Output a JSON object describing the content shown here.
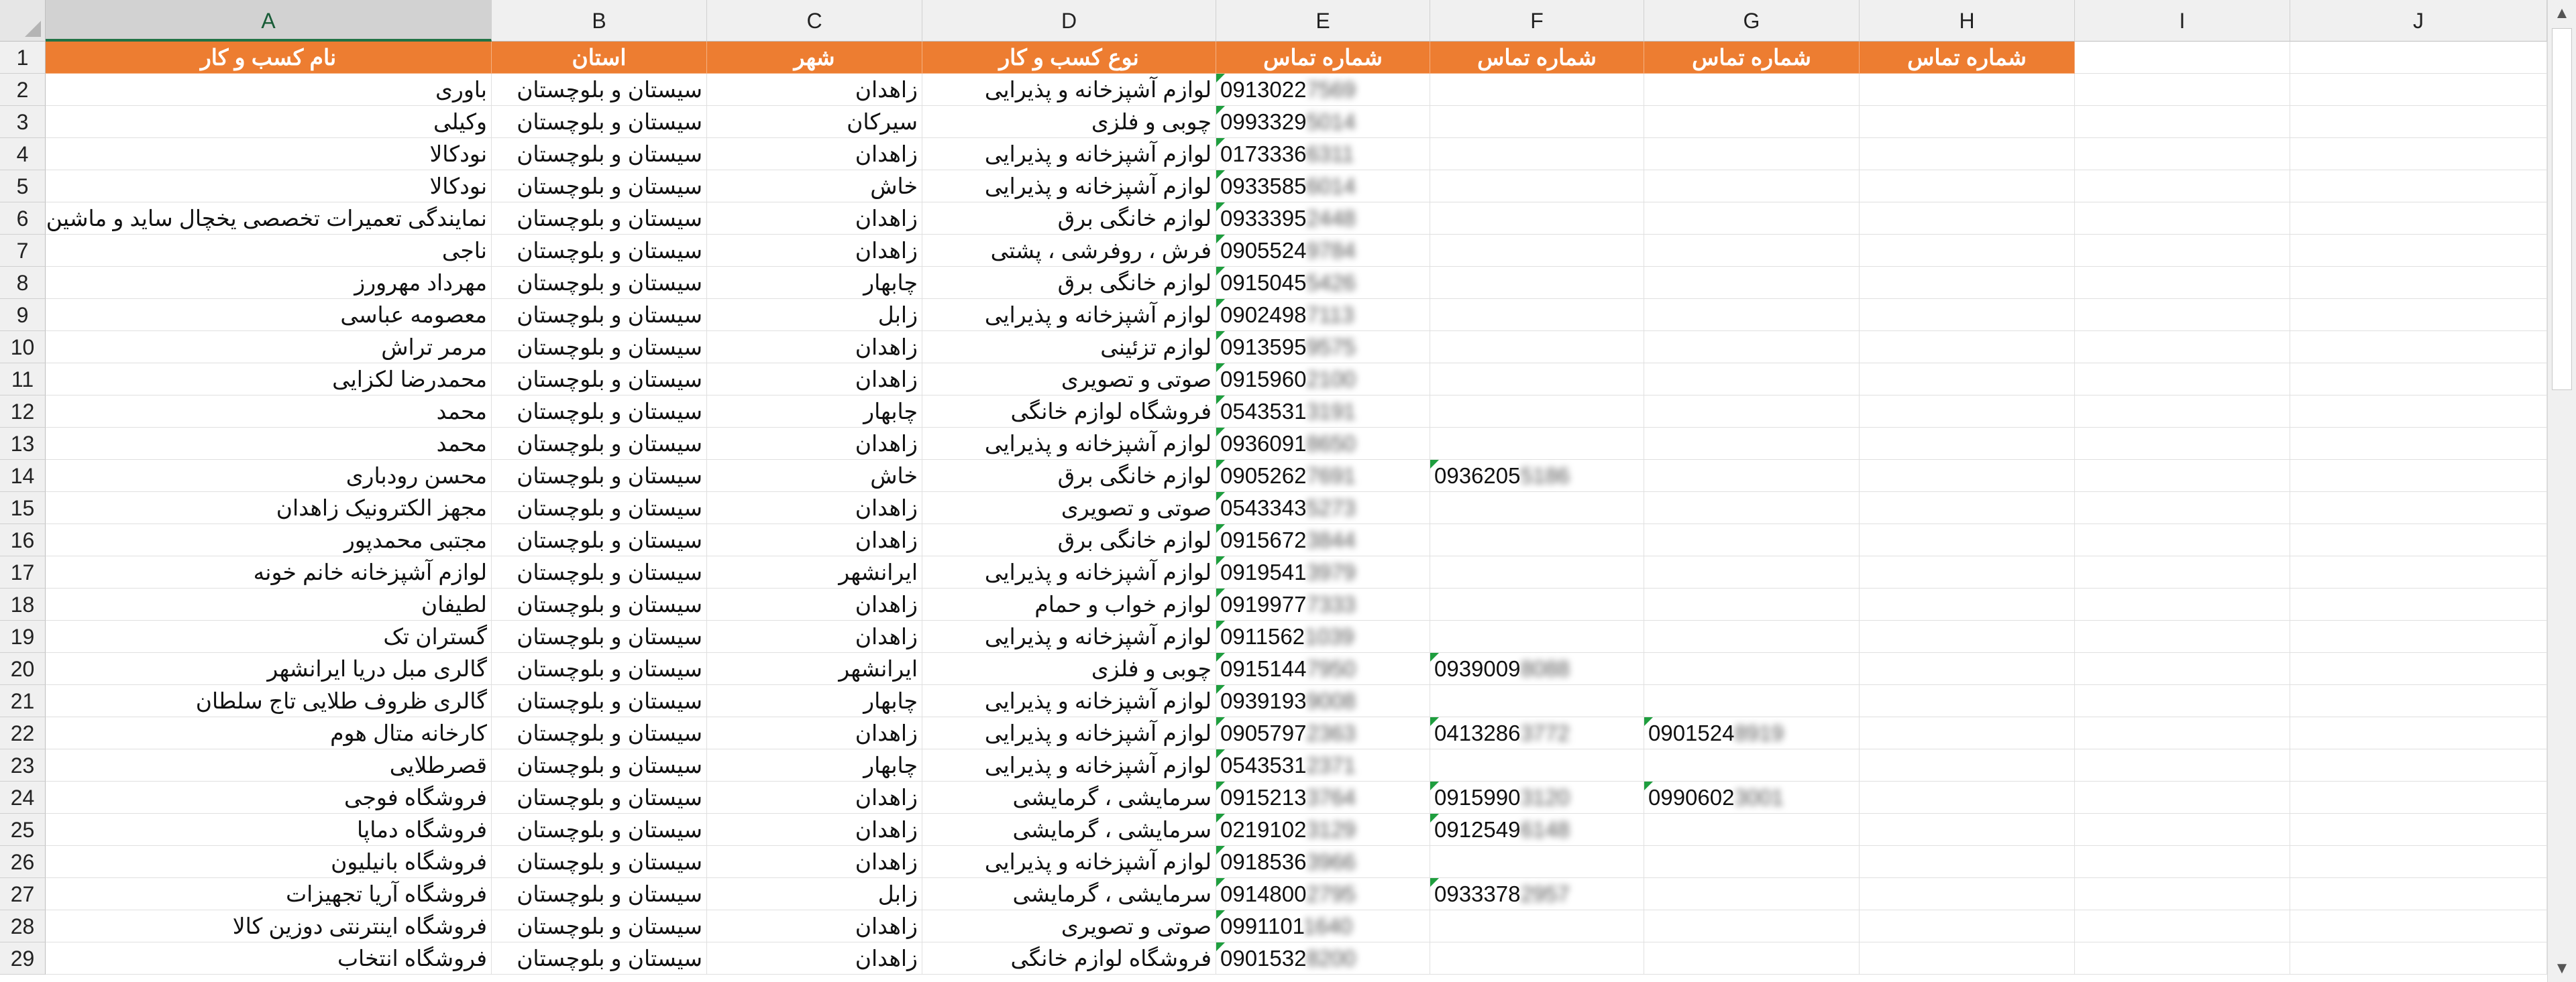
{
  "columns": [
    "A",
    "B",
    "C",
    "D",
    "E",
    "F",
    "G",
    "H",
    "I",
    "J"
  ],
  "header_row": [
    "نام کسب و کار",
    "استان",
    "شهر",
    "نوع کسب و کار",
    "شماره تماس",
    "شماره تماس",
    "شماره تماس",
    "شماره تماس",
    "",
    ""
  ],
  "rows": [
    {
      "n": "2",
      "name": "باوری",
      "province": "سیستان و بلوچستان",
      "city": "زاهدان",
      "type": "لوازم آشپزخانه و پذیرایی",
      "p1": "0913022",
      "p1h": "7569"
    },
    {
      "n": "3",
      "name": "وکیلی",
      "province": "سیستان و بلوچستان",
      "city": "سیرکان",
      "type": "چوبی و فلزی",
      "p1": "0993329",
      "p1h": "5014"
    },
    {
      "n": "4",
      "name": "نودکالا",
      "province": "سیستان و بلوچستان",
      "city": "زاهدان",
      "type": "لوازم آشپزخانه و پذیرایی",
      "p1": "0173336",
      "p1h": "6311"
    },
    {
      "n": "5",
      "name": "نودکالا",
      "province": "سیستان و بلوچستان",
      "city": "خاش",
      "type": "لوازم آشپزخانه و پذیرایی",
      "p1": "0933585",
      "p1h": "6014"
    },
    {
      "n": "6",
      "name": "نمایندگی تعمیرات تخصصی یخچال ساید و ماشین",
      "province": "سیستان و بلوچستان",
      "city": "زاهدان",
      "type": "لوازم خانگی برق",
      "p1": "0933395",
      "p1h": "2448"
    },
    {
      "n": "7",
      "name": "ناجی",
      "province": "سیستان و بلوچستان",
      "city": "زاهدان",
      "type": "فرش ، روفرشی ، پشتی",
      "p1": "0905524",
      "p1h": "9784"
    },
    {
      "n": "8",
      "name": "مهرداد مهرورز",
      "province": "سیستان و بلوچستان",
      "city": "چابهار",
      "type": "لوازم خانگی برق",
      "p1": "0915045",
      "p1h": "5426"
    },
    {
      "n": "9",
      "name": "معصومه عباسی",
      "province": "سیستان و بلوچستان",
      "city": "زابل",
      "type": "لوازم آشپزخانه و پذیرایی",
      "p1": "0902498",
      "p1h": "7113"
    },
    {
      "n": "10",
      "name": "مرمر تراش",
      "province": "سیستان و بلوچستان",
      "city": "زاهدان",
      "type": "لوازم تزئینی",
      "p1": "0913595",
      "p1h": "9575"
    },
    {
      "n": "11",
      "name": "محمدرضا لکزایی",
      "province": "سیستان و بلوچستان",
      "city": "زاهدان",
      "type": "صوتی و تصویری",
      "p1": "0915960",
      "p1h": "2100"
    },
    {
      "n": "12",
      "name": "محمد",
      "province": "سیستان و بلوچستان",
      "city": "چابهار",
      "type": "فروشگاه لوازم خانگی",
      "p1": "0543531",
      "p1h": "3191"
    },
    {
      "n": "13",
      "name": "محمد",
      "province": "سیستان و بلوچستان",
      "city": "زاهدان",
      "type": "لوازم آشپزخانه و پذیرایی",
      "p1": "0936091",
      "p1h": "8650"
    },
    {
      "n": "14",
      "name": "محسن رودباری",
      "province": "سیستان و بلوچستان",
      "city": "خاش",
      "type": "لوازم خانگی برق",
      "p1": "0905262",
      "p1h": "7691",
      "p2": "0936205",
      "p2h": "5186"
    },
    {
      "n": "15",
      "name": "مجهز الکترونیک زاهدان",
      "province": "سیستان و بلوچستان",
      "city": "زاهدان",
      "type": "صوتی و تصویری",
      "p1": "0543343",
      "p1h": "5273"
    },
    {
      "n": "16",
      "name": "مجتبی محمدپور",
      "province": "سیستان و بلوچستان",
      "city": "زاهدان",
      "type": "لوازم خانگی برق",
      "p1": "0915672",
      "p1h": "3844"
    },
    {
      "n": "17",
      "name": "لوازم آشپزخانه خانم خونه",
      "province": "سیستان و بلوچستان",
      "city": "ایرانشهر",
      "type": "لوازم آشپزخانه و پذیرایی",
      "p1": "0919541",
      "p1h": "3979"
    },
    {
      "n": "18",
      "name": "لطیفان",
      "province": "سیستان و بلوچستان",
      "city": "زاهدان",
      "type": "لوازم خواب و حمام",
      "p1": "0919977",
      "p1h": "7333"
    },
    {
      "n": "19",
      "name": "گستران تک",
      "province": "سیستان و بلوچستان",
      "city": "زاهدان",
      "type": "لوازم آشپزخانه و پذیرایی",
      "p1": "0911562",
      "p1h": "1039"
    },
    {
      "n": "20",
      "name": "گالری مبل دریا ایرانشهر",
      "province": "سیستان و بلوچستان",
      "city": "ایرانشهر",
      "type": "چوبی و فلزی",
      "p1": "0915144",
      "p1h": "7950",
      "p2": "0939009",
      "p2h": "8088"
    },
    {
      "n": "21",
      "name": "گالری ظروف طلایی تاج سلطان",
      "province": "سیستان و بلوچستان",
      "city": "چابهار",
      "type": "لوازم آشپزخانه و پذیرایی",
      "p1": "0939193",
      "p1h": "9008"
    },
    {
      "n": "22",
      "name": "کارخانه متال هوم",
      "province": "سیستان و بلوچستان",
      "city": "زاهدان",
      "type": "لوازم آشپزخانه و پذیرایی",
      "p1": "0905797",
      "p1h": "2363",
      "p2": "0413286",
      "p2h": "3772",
      "p3": "0901524",
      "p3h": "8919"
    },
    {
      "n": "23",
      "name": "قصرطلایی",
      "province": "سیستان و بلوچستان",
      "city": "چابهار",
      "type": "لوازم آشپزخانه و پذیرایی",
      "p1": "0543531",
      "p1h": "2371"
    },
    {
      "n": "24",
      "name": "فروشگاه فوجی",
      "province": "سیستان و بلوچستان",
      "city": "زاهدان",
      "type": "سرمایشی ، گرمایشی",
      "p1": "0915213",
      "p1h": "3764",
      "p2": "0915990",
      "p2h": "3120",
      "p3": "0990602",
      "p3h": "3001"
    },
    {
      "n": "25",
      "name": "فروشگاه دماپا",
      "province": "سیستان و بلوچستان",
      "city": "زاهدان",
      "type": "سرمایشی ، گرمایشی",
      "p1": "0219102",
      "p1h": "3129",
      "p2": "0912549",
      "p2h": "6148"
    },
    {
      "n": "26",
      "name": "فروشگاه بانیلیون",
      "province": "سیستان و بلوچستان",
      "city": "زاهدان",
      "type": "لوازم آشپزخانه و پذیرایی",
      "p1": "0918536",
      "p1h": "3966"
    },
    {
      "n": "27",
      "name": "فروشگاه آریا تجهیزات",
      "province": "سیستان و بلوچستان",
      "city": "زابل",
      "type": "سرمایشی ، گرمایشی",
      "p1": "0914800",
      "p1h": "2795",
      "p2": "0933378",
      "p2h": "2957"
    },
    {
      "n": "28",
      "name": "فروشگاه اینترنتی دوزین کالا",
      "province": "سیستان و بلوچستان",
      "city": "زاهدان",
      "type": "صوتی و تصویری",
      "p1": "0991101",
      "p1h": "1640"
    },
    {
      "n": "29",
      "name": "فروشگاه انتخاب",
      "province": "سیستان و بلوچستان",
      "city": "زاهدان",
      "type": "فروشگاه لوازم خانگی",
      "p1": "0901532",
      "p1h": "8200"
    }
  ],
  "scroll": {
    "up": "▲",
    "down": "▼"
  }
}
